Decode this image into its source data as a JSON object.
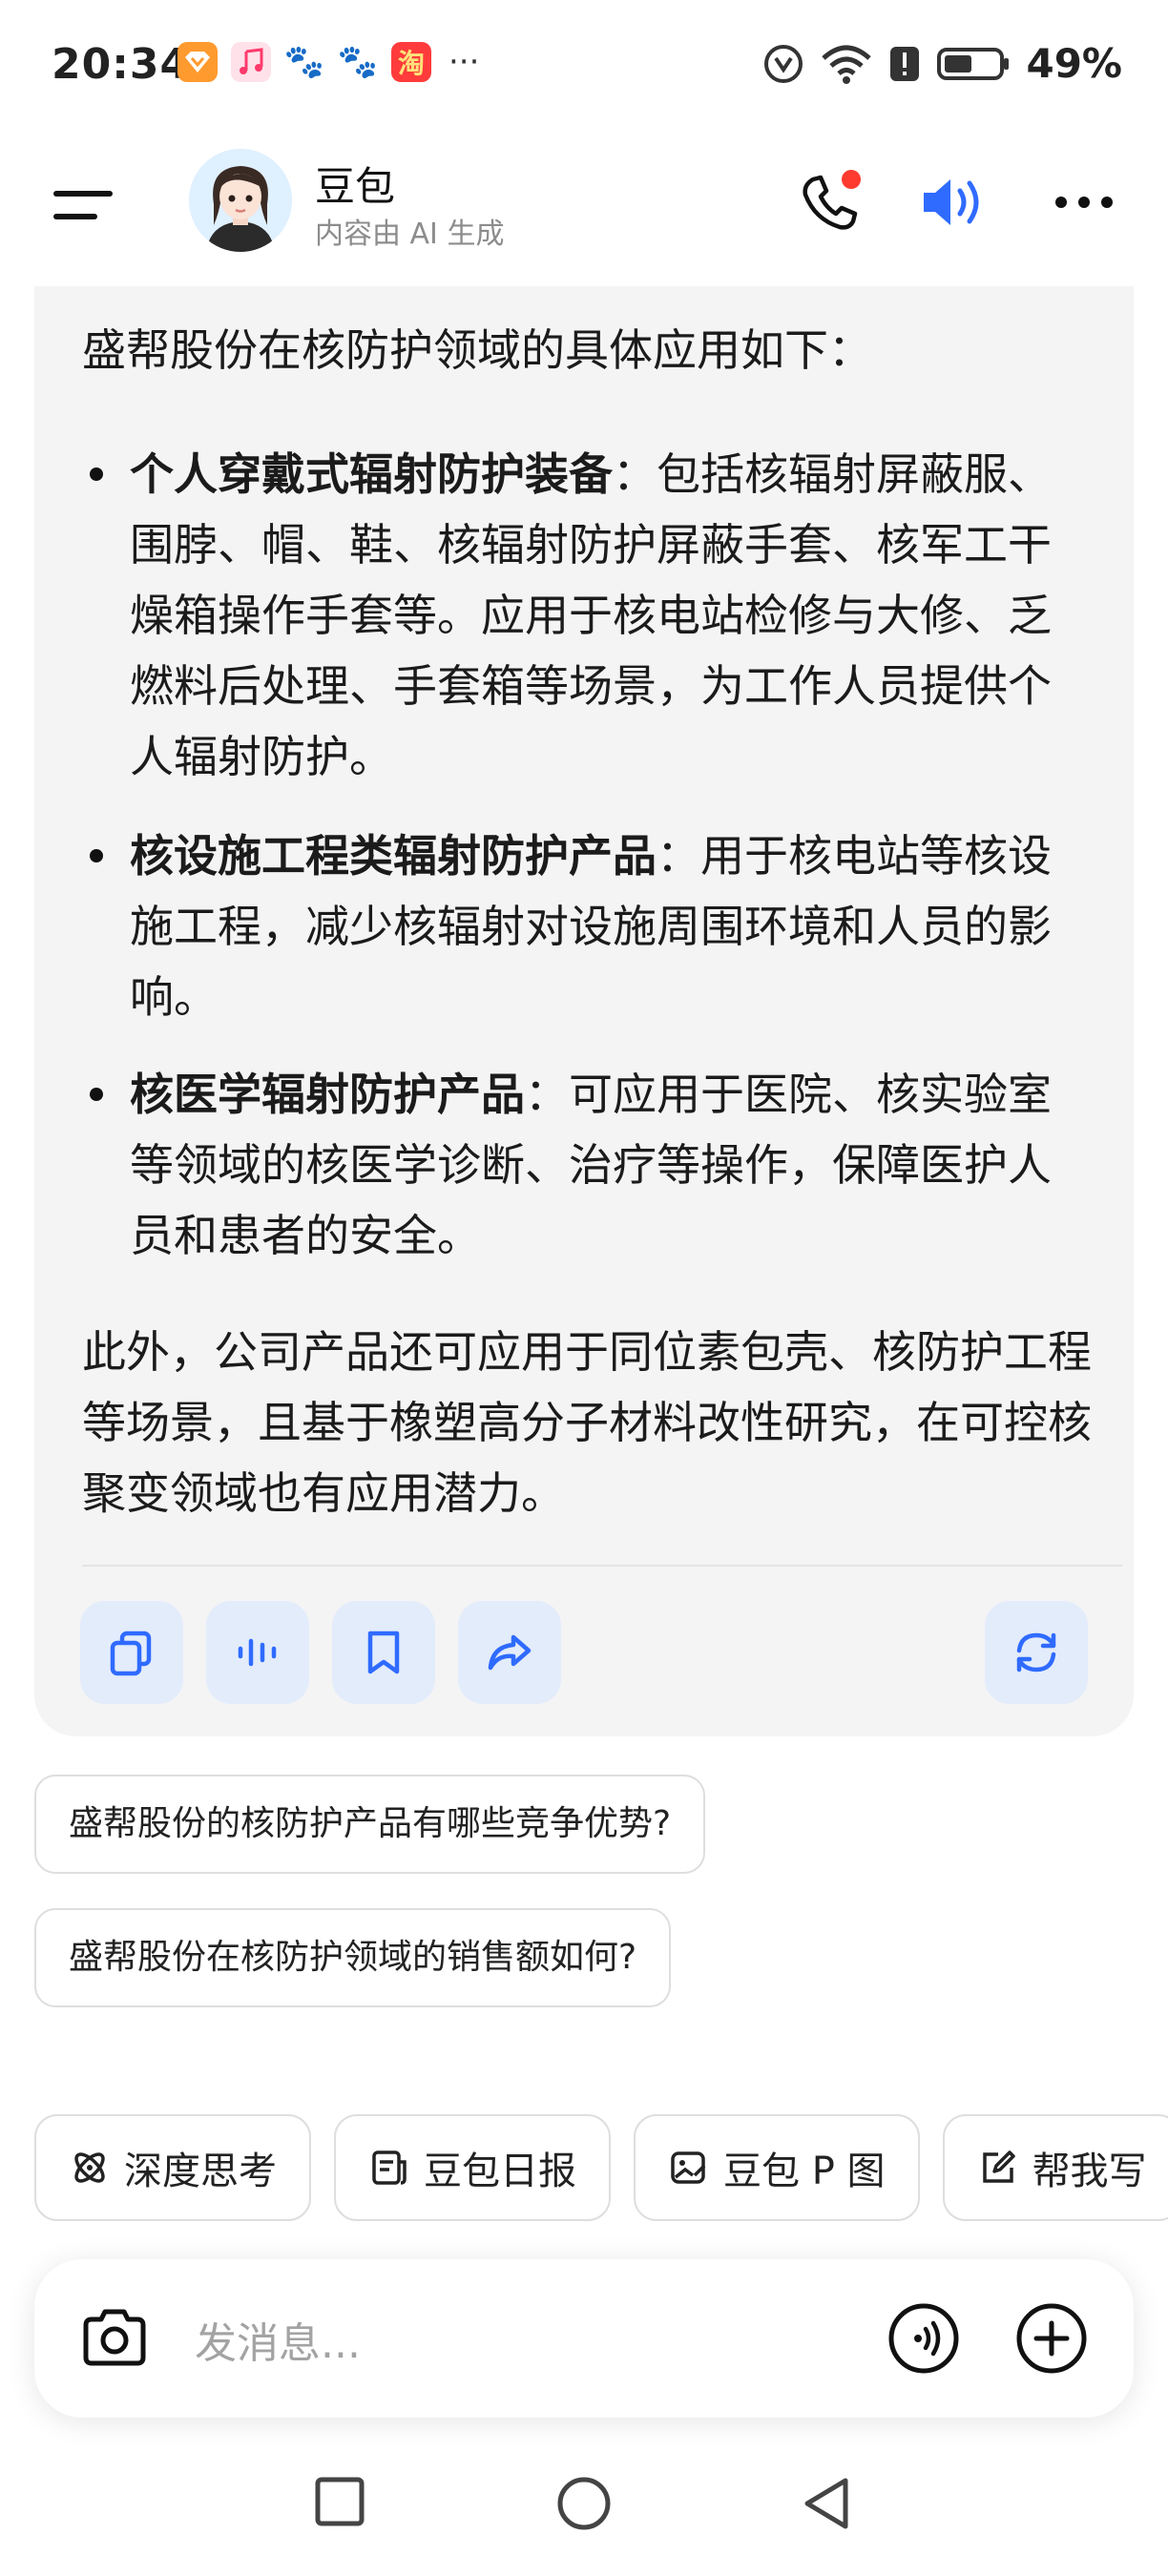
{
  "status_bar": {
    "time": "20:34",
    "app_icons": [
      "vip-icon",
      "music-icon",
      "baidu-icon",
      "baidu-icon",
      "taobao-icon"
    ],
    "taobao_glyph": "淘",
    "baidu_glyph": "🐾",
    "more": "···",
    "battery": "49%"
  },
  "header": {
    "bot_name": "豆包",
    "bot_subtitle": "内容由 AI 生成"
  },
  "message": {
    "intro": "盛帮股份在核防护领域的具体应用如下：",
    "bullets": [
      {
        "title": "个人穿戴式辐射防护装备",
        "text": "：包括核辐射屏蔽服、围脖、帽、鞋、核辐射防护屏蔽手套、核军工干燥箱操作手套等。应用于核电站检修与大修、乏燃料后处理、手套箱等场景，为工作人员提供个人辐射防护。"
      },
      {
        "title": "核设施工程类辐射防护产品",
        "text": "：用于核电站等核设施工程，减少核辐射对设施周围环境和人员的影响。"
      },
      {
        "title": "核医学辐射防护产品",
        "text": "：可应用于医院、核实验室等领域的核医学诊断、治疗等操作，保障医护人员和患者的安全。"
      }
    ],
    "outro": "此外，公司产品还可应用于同位素包壳、核防护工程等场景，且基于橡塑高分子材料改性研究，在可控核聚变领域也有应用潜力。"
  },
  "suggestions": [
    "盛帮股份的核防护产品有哪些竞争优势?",
    "盛帮股份在核防护领域的销售额如何?"
  ],
  "chips": [
    {
      "label": "深度思考",
      "icon": "atom-icon"
    },
    {
      "label": "豆包日报",
      "icon": "news-icon"
    },
    {
      "label": "豆包 P 图",
      "icon": "image-edit-icon"
    },
    {
      "label": "帮我写",
      "icon": "write-icon"
    }
  ],
  "input": {
    "placeholder": "发消息..."
  },
  "colors": {
    "accent": "#2f6bff",
    "notification_dot": "#ff3b30",
    "card_bg": "#f4f4f5",
    "action_bg": "#e3ecfb"
  }
}
